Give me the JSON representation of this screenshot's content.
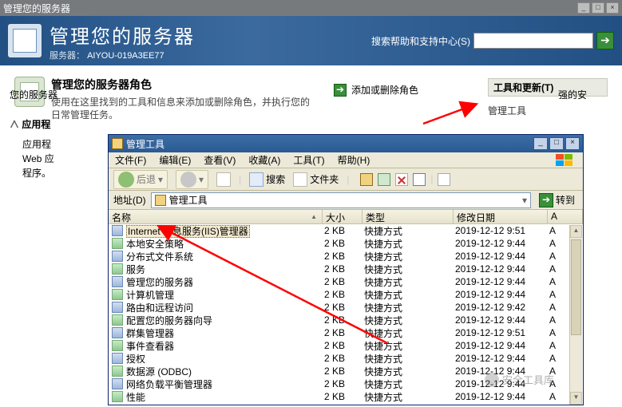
{
  "bg": {
    "titlebar": "管理您的服务器",
    "headerTitle": "管理您的服务器",
    "serverLabel": "服务器：",
    "serverName": "AIYOU-019A3EE77",
    "searchLabel": "搜索帮助和支持中心(S)"
  },
  "roles": {
    "title": "管理您的服务器角色",
    "desc1": "使用在这里找到的工具和信息来添加或删除角色，并执行您的",
    "desc2": "日常管理任务。"
  },
  "midLink": "添加或删除角色",
  "rightPanel": {
    "title": "工具和更新(T)",
    "link1": "管理工具"
  },
  "leftLabels": {
    "yourServer": "您的服务器",
    "secSuffix": "强的安",
    "appGroup": "应用程",
    "s1": "应用程",
    "s2": "Web 应",
    "s3": "程序。"
  },
  "admin": {
    "title": "管理工具",
    "menu": {
      "file": "文件(F)",
      "edit": "编辑(E)",
      "view": "查看(V)",
      "fav": "收藏(A)",
      "tools": "工具(T)",
      "help": "帮助(H)"
    },
    "toolbar": {
      "back": "后退",
      "search": "搜索",
      "folders": "文件夹"
    },
    "address": {
      "label": "地址(D)",
      "value": "管理工具",
      "go": "转到"
    },
    "cols": {
      "name": "名称",
      "size": "大小",
      "type": "类型",
      "date": "修改日期",
      "att": "A"
    },
    "rows": [
      {
        "name": "Internet 信息服务(IIS)管理器",
        "size": "2 KB",
        "type": "快捷方式",
        "date": "2019-12-12 9:51",
        "att": "A"
      },
      {
        "name": "本地安全策略",
        "size": "2 KB",
        "type": "快捷方式",
        "date": "2019-12-12 9:44",
        "att": "A"
      },
      {
        "name": "分布式文件系统",
        "size": "2 KB",
        "type": "快捷方式",
        "date": "2019-12-12 9:44",
        "att": "A"
      },
      {
        "name": "服务",
        "size": "2 KB",
        "type": "快捷方式",
        "date": "2019-12-12 9:44",
        "att": "A"
      },
      {
        "name": "管理您的服务器",
        "size": "2 KB",
        "type": "快捷方式",
        "date": "2019-12-12 9:44",
        "att": "A"
      },
      {
        "name": "计算机管理",
        "size": "2 KB",
        "type": "快捷方式",
        "date": "2019-12-12 9:44",
        "att": "A"
      },
      {
        "name": "路由和远程访问",
        "size": "2 KB",
        "type": "快捷方式",
        "date": "2019-12-12 9:42",
        "att": "A"
      },
      {
        "name": "配置您的服务器向导",
        "size": "2 KB",
        "type": "快捷方式",
        "date": "2019-12-12 9:44",
        "att": "A"
      },
      {
        "name": "群集管理器",
        "size": "2 KB",
        "type": "快捷方式",
        "date": "2019-12-12 9:51",
        "att": "A"
      },
      {
        "name": "事件查看器",
        "size": "2 KB",
        "type": "快捷方式",
        "date": "2019-12-12 9:44",
        "att": "A"
      },
      {
        "name": "授权",
        "size": "2 KB",
        "type": "快捷方式",
        "date": "2019-12-12 9:44",
        "att": "A"
      },
      {
        "name": "数据源 (ODBC)",
        "size": "2 KB",
        "type": "快捷方式",
        "date": "2019-12-12 9:44",
        "att": "A"
      },
      {
        "name": "网络负载平衡管理器",
        "size": "2 KB",
        "type": "快捷方式",
        "date": "2019-12-12 9:44",
        "att": "A"
      },
      {
        "name": "性能",
        "size": "2 KB",
        "type": "快捷方式",
        "date": "2019-12-12 9:44",
        "att": "A"
      }
    ]
  },
  "watermark": "安全工具库"
}
